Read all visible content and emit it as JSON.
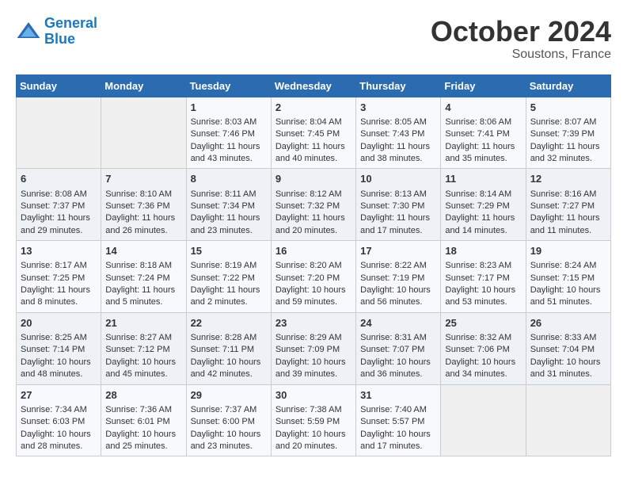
{
  "header": {
    "logo_line1": "General",
    "logo_line2": "Blue",
    "month": "October 2024",
    "location": "Soustons, France"
  },
  "weekdays": [
    "Sunday",
    "Monday",
    "Tuesday",
    "Wednesday",
    "Thursday",
    "Friday",
    "Saturday"
  ],
  "weeks": [
    [
      {
        "day": "",
        "sunrise": "",
        "sunset": "",
        "daylight": ""
      },
      {
        "day": "",
        "sunrise": "",
        "sunset": "",
        "daylight": ""
      },
      {
        "day": "1",
        "sunrise": "Sunrise: 8:03 AM",
        "sunset": "Sunset: 7:46 PM",
        "daylight": "Daylight: 11 hours and 43 minutes."
      },
      {
        "day": "2",
        "sunrise": "Sunrise: 8:04 AM",
        "sunset": "Sunset: 7:45 PM",
        "daylight": "Daylight: 11 hours and 40 minutes."
      },
      {
        "day": "3",
        "sunrise": "Sunrise: 8:05 AM",
        "sunset": "Sunset: 7:43 PM",
        "daylight": "Daylight: 11 hours and 38 minutes."
      },
      {
        "day": "4",
        "sunrise": "Sunrise: 8:06 AM",
        "sunset": "Sunset: 7:41 PM",
        "daylight": "Daylight: 11 hours and 35 minutes."
      },
      {
        "day": "5",
        "sunrise": "Sunrise: 8:07 AM",
        "sunset": "Sunset: 7:39 PM",
        "daylight": "Daylight: 11 hours and 32 minutes."
      }
    ],
    [
      {
        "day": "6",
        "sunrise": "Sunrise: 8:08 AM",
        "sunset": "Sunset: 7:37 PM",
        "daylight": "Daylight: 11 hours and 29 minutes."
      },
      {
        "day": "7",
        "sunrise": "Sunrise: 8:10 AM",
        "sunset": "Sunset: 7:36 PM",
        "daylight": "Daylight: 11 hours and 26 minutes."
      },
      {
        "day": "8",
        "sunrise": "Sunrise: 8:11 AM",
        "sunset": "Sunset: 7:34 PM",
        "daylight": "Daylight: 11 hours and 23 minutes."
      },
      {
        "day": "9",
        "sunrise": "Sunrise: 8:12 AM",
        "sunset": "Sunset: 7:32 PM",
        "daylight": "Daylight: 11 hours and 20 minutes."
      },
      {
        "day": "10",
        "sunrise": "Sunrise: 8:13 AM",
        "sunset": "Sunset: 7:30 PM",
        "daylight": "Daylight: 11 hours and 17 minutes."
      },
      {
        "day": "11",
        "sunrise": "Sunrise: 8:14 AM",
        "sunset": "Sunset: 7:29 PM",
        "daylight": "Daylight: 11 hours and 14 minutes."
      },
      {
        "day": "12",
        "sunrise": "Sunrise: 8:16 AM",
        "sunset": "Sunset: 7:27 PM",
        "daylight": "Daylight: 11 hours and 11 minutes."
      }
    ],
    [
      {
        "day": "13",
        "sunrise": "Sunrise: 8:17 AM",
        "sunset": "Sunset: 7:25 PM",
        "daylight": "Daylight: 11 hours and 8 minutes."
      },
      {
        "day": "14",
        "sunrise": "Sunrise: 8:18 AM",
        "sunset": "Sunset: 7:24 PM",
        "daylight": "Daylight: 11 hours and 5 minutes."
      },
      {
        "day": "15",
        "sunrise": "Sunrise: 8:19 AM",
        "sunset": "Sunset: 7:22 PM",
        "daylight": "Daylight: 11 hours and 2 minutes."
      },
      {
        "day": "16",
        "sunrise": "Sunrise: 8:20 AM",
        "sunset": "Sunset: 7:20 PM",
        "daylight": "Daylight: 10 hours and 59 minutes."
      },
      {
        "day": "17",
        "sunrise": "Sunrise: 8:22 AM",
        "sunset": "Sunset: 7:19 PM",
        "daylight": "Daylight: 10 hours and 56 minutes."
      },
      {
        "day": "18",
        "sunrise": "Sunrise: 8:23 AM",
        "sunset": "Sunset: 7:17 PM",
        "daylight": "Daylight: 10 hours and 53 minutes."
      },
      {
        "day": "19",
        "sunrise": "Sunrise: 8:24 AM",
        "sunset": "Sunset: 7:15 PM",
        "daylight": "Daylight: 10 hours and 51 minutes."
      }
    ],
    [
      {
        "day": "20",
        "sunrise": "Sunrise: 8:25 AM",
        "sunset": "Sunset: 7:14 PM",
        "daylight": "Daylight: 10 hours and 48 minutes."
      },
      {
        "day": "21",
        "sunrise": "Sunrise: 8:27 AM",
        "sunset": "Sunset: 7:12 PM",
        "daylight": "Daylight: 10 hours and 45 minutes."
      },
      {
        "day": "22",
        "sunrise": "Sunrise: 8:28 AM",
        "sunset": "Sunset: 7:11 PM",
        "daylight": "Daylight: 10 hours and 42 minutes."
      },
      {
        "day": "23",
        "sunrise": "Sunrise: 8:29 AM",
        "sunset": "Sunset: 7:09 PM",
        "daylight": "Daylight: 10 hours and 39 minutes."
      },
      {
        "day": "24",
        "sunrise": "Sunrise: 8:31 AM",
        "sunset": "Sunset: 7:07 PM",
        "daylight": "Daylight: 10 hours and 36 minutes."
      },
      {
        "day": "25",
        "sunrise": "Sunrise: 8:32 AM",
        "sunset": "Sunset: 7:06 PM",
        "daylight": "Daylight: 10 hours and 34 minutes."
      },
      {
        "day": "26",
        "sunrise": "Sunrise: 8:33 AM",
        "sunset": "Sunset: 7:04 PM",
        "daylight": "Daylight: 10 hours and 31 minutes."
      }
    ],
    [
      {
        "day": "27",
        "sunrise": "Sunrise: 7:34 AM",
        "sunset": "Sunset: 6:03 PM",
        "daylight": "Daylight: 10 hours and 28 minutes."
      },
      {
        "day": "28",
        "sunrise": "Sunrise: 7:36 AM",
        "sunset": "Sunset: 6:01 PM",
        "daylight": "Daylight: 10 hours and 25 minutes."
      },
      {
        "day": "29",
        "sunrise": "Sunrise: 7:37 AM",
        "sunset": "Sunset: 6:00 PM",
        "daylight": "Daylight: 10 hours and 23 minutes."
      },
      {
        "day": "30",
        "sunrise": "Sunrise: 7:38 AM",
        "sunset": "Sunset: 5:59 PM",
        "daylight": "Daylight: 10 hours and 20 minutes."
      },
      {
        "day": "31",
        "sunrise": "Sunrise: 7:40 AM",
        "sunset": "Sunset: 5:57 PM",
        "daylight": "Daylight: 10 hours and 17 minutes."
      },
      {
        "day": "",
        "sunrise": "",
        "sunset": "",
        "daylight": ""
      },
      {
        "day": "",
        "sunrise": "",
        "sunset": "",
        "daylight": ""
      }
    ]
  ]
}
